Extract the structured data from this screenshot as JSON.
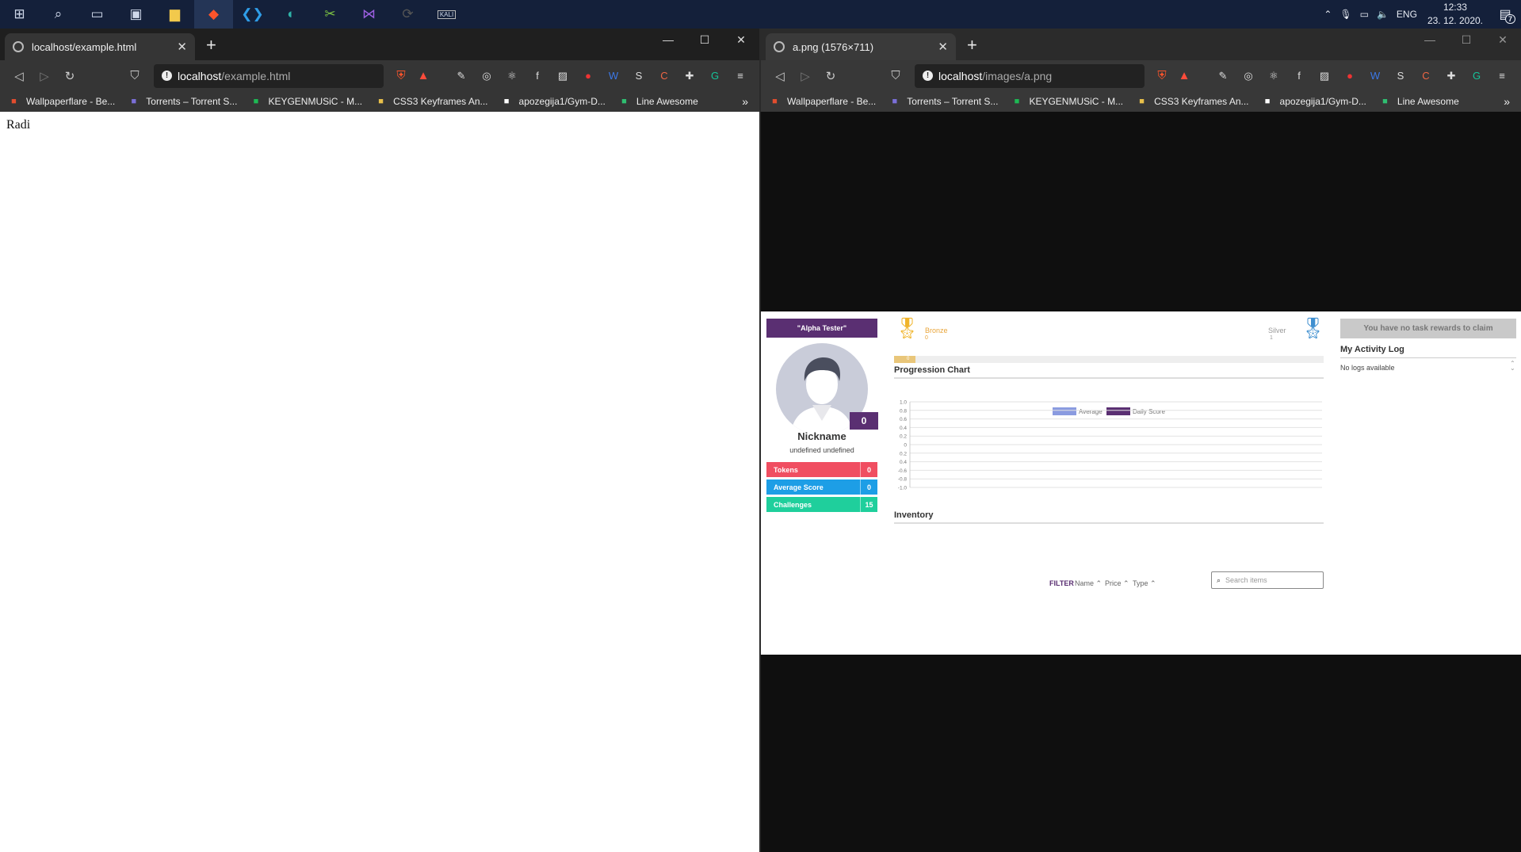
{
  "taskbar": {
    "language": "ENG",
    "time": "12:33",
    "date": "23. 12. 2020.",
    "notification_count": "7",
    "kali_label": "KALI"
  },
  "left_window": {
    "tab_title": "localhost/example.html",
    "url_host": "localhost",
    "url_path": "/example.html",
    "page_text": "Radi"
  },
  "right_window": {
    "tab_title": "a.png (1576×711)",
    "url_host": "localhost",
    "url_path": "/images/a.png"
  },
  "bookmarks": [
    {
      "label": "Wallpaperflare - Be...",
      "icon": "flame-icon",
      "color": "#e24d2e"
    },
    {
      "label": "Torrents – Torrent S...",
      "icon": "torrent-icon",
      "color": "#7b6fd8"
    },
    {
      "label": "KEYGENMUSiC - M...",
      "icon": "k-icon",
      "color": "#1db954"
    },
    {
      "label": "CSS3 Keyframes An...",
      "icon": "runner-icon",
      "color": "#e8c04a"
    },
    {
      "label": "apozegija1/Gym-D...",
      "icon": "github-icon",
      "color": "#ffffff"
    },
    {
      "label": "Line Awesome",
      "icon": "line-awesome-icon",
      "color": "#2fbf71"
    }
  ],
  "shot": {
    "title_badge": "\"Alpha Tester\"",
    "level": "0",
    "nickname": "Nickname",
    "fullname": "undefined undefined",
    "stats": [
      {
        "label": "Tokens",
        "value": "0",
        "color": "#f04e61"
      },
      {
        "label": "Average Score",
        "value": "0",
        "color": "#1d9ee6"
      },
      {
        "label": "Challenges",
        "value": "15",
        "color": "#1fcf9c"
      }
    ],
    "bronze_label": "Bronze",
    "bronze_value": "0",
    "silver_label": "Silver",
    "silver_value": "1",
    "progress_label": "0",
    "progress_fraction": 0.05,
    "progression_title": "Progression Chart",
    "inventory_title": "Inventory",
    "filter_label": "FILTER",
    "sort_name": "Name",
    "sort_price": "Price",
    "sort_type": "Type",
    "search_placeholder": "Search items",
    "claim_button": "You have no task rewards to claim",
    "activity_title": "My Activity Log",
    "no_logs": "No logs available"
  },
  "chart_data": {
    "type": "line",
    "series": [
      {
        "name": "Average",
        "color": "#8a9be0",
        "values": []
      },
      {
        "name": "Daily Score",
        "color": "#5a2f72",
        "values": []
      }
    ],
    "y_ticks": [
      "1.0",
      "0.8",
      "0.6",
      "0.4",
      "0.2",
      "0",
      "0.2",
      "0.4",
      "-0.6",
      "-0.8",
      "-1.0"
    ],
    "ylim": [
      -1.0,
      1.0
    ],
    "grid": true,
    "legend": "top-center"
  }
}
